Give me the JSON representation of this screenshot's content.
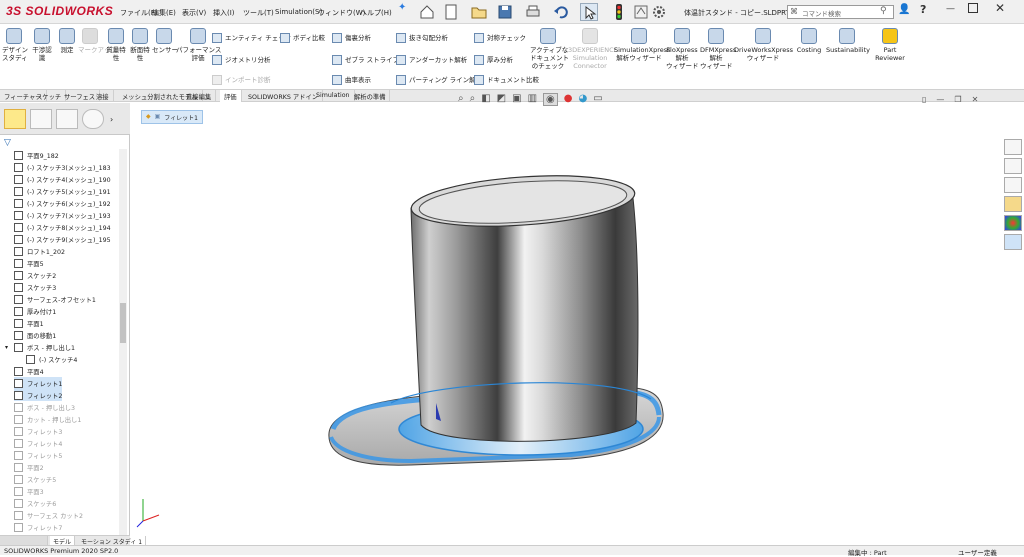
{
  "app": {
    "logo_mark": "3S",
    "logo_text": "SOLIDWORKS",
    "document_title": "体温計スタンド - コピー.SLDPRT *",
    "search_placeholder": "コマンド検索"
  },
  "menus": [
    "ファイル(F)",
    "編集(E)",
    "表示(V)",
    "挿入(I)",
    "ツール(T)",
    "Simulation(S)",
    "ウィンドウ(W)",
    "ヘルプ(H)"
  ],
  "ribbon": {
    "big_left": [
      {
        "label": "デザイン\nスタディ"
      },
      {
        "label": "干渉認\n識"
      },
      {
        "label": "測定"
      },
      {
        "label": "マークアップ",
        "disabled": true
      },
      {
        "label": "質量特\n性"
      },
      {
        "label": "断面特\n性"
      },
      {
        "label": "センサー"
      },
      {
        "label": "パフォーマンス\n評価"
      }
    ],
    "small_col1": [
      {
        "label": "エンティティ チェック"
      },
      {
        "label": "ジオメトリ分析"
      },
      {
        "label": "インポート診断",
        "disabled": true
      }
    ],
    "small_col1b": [
      {
        "label": "ボディ比較"
      }
    ],
    "small_col2": [
      {
        "label": "傷裏分析"
      },
      {
        "label": "ゼブラ ストライプ"
      },
      {
        "label": "曲率表示"
      }
    ],
    "small_col3": [
      {
        "label": "抜き勾配分析"
      },
      {
        "label": "アンダーカット解析"
      },
      {
        "label": "パーティング ライン解析"
      }
    ],
    "small_col4": [
      {
        "label": "対称チェック"
      },
      {
        "label": "厚み分析"
      },
      {
        "label": "ドキュメント比較"
      }
    ],
    "big_right": [
      {
        "label": "アクティブな\nドキュメント\nのチェック"
      },
      {
        "label": "3DEXPERIENCE\nSimulation\nConnector",
        "disabled": true
      },
      {
        "label": "SimulationXpress\n解析ウィザード"
      },
      {
        "label": "FloXpress\n解析\nウィザード"
      },
      {
        "label": "DFMXpress\n解析\nウィザード"
      },
      {
        "label": "DriveWorksXpress\nウィザード"
      },
      {
        "label": "Costing"
      },
      {
        "label": "Sustainability"
      },
      {
        "label": "Part\nReviewer"
      }
    ]
  },
  "tabs": [
    {
      "label": "フィーチャー"
    },
    {
      "label": "スケッチ"
    },
    {
      "label": "サーフェス"
    },
    {
      "label": "溶接"
    },
    {
      "label": "メッシュ分割されたモデル"
    },
    {
      "label": "直接編集"
    },
    {
      "label": "評価",
      "active": true
    },
    {
      "label": "SOLIDWORKS アドイン"
    },
    {
      "label": "Simulation"
    },
    {
      "label": "解析の準備"
    }
  ],
  "breadcrumb": [
    "フィレット1"
  ],
  "tree": [
    {
      "label": "平面9_182",
      "indent": 0
    },
    {
      "label": "(-) スケッチ3(メッシュ)_183",
      "indent": 0
    },
    {
      "label": "(-) スケッチ4(メッシュ)_190",
      "indent": 0
    },
    {
      "label": "(-) スケッチ5(メッシュ)_191",
      "indent": 0
    },
    {
      "label": "(-) スケッチ6(メッシュ)_192",
      "indent": 0
    },
    {
      "label": "(-) スケッチ7(メッシュ)_193",
      "indent": 0
    },
    {
      "label": "(-) スケッチ8(メッシュ)_194",
      "indent": 0
    },
    {
      "label": "(-) スケッチ9(メッシュ)_195",
      "indent": 0
    },
    {
      "label": "ロフト1_202",
      "indent": 0
    },
    {
      "label": "平面5",
      "indent": 0
    },
    {
      "label": "スケッチ2",
      "indent": 0
    },
    {
      "label": "スケッチ3",
      "indent": 0
    },
    {
      "label": "サーフェス-オフセット1",
      "indent": 0
    },
    {
      "label": "厚み付け1",
      "indent": 0
    },
    {
      "label": "平面1",
      "indent": 0
    },
    {
      "label": "面の移動1",
      "indent": 0
    },
    {
      "label": "ボス - 押し出し1",
      "indent": 0,
      "expanded": true
    },
    {
      "label": "(-) スケッチ4",
      "indent": 1
    },
    {
      "label": "平面4",
      "indent": 0
    },
    {
      "label": "フィレット1",
      "indent": 0,
      "selected": true
    },
    {
      "label": "フィレット2",
      "indent": 0,
      "selected": true
    },
    {
      "label": "ボス - 押し出し3",
      "indent": 0,
      "grey": true
    },
    {
      "label": "カット - 押し出し1",
      "indent": 0,
      "grey": true
    },
    {
      "label": "フィレット3",
      "indent": 0,
      "grey": true
    },
    {
      "label": "フィレット4",
      "indent": 0,
      "grey": true
    },
    {
      "label": "フィレット5",
      "indent": 0,
      "grey": true
    },
    {
      "label": "平面2",
      "indent": 0,
      "grey": true
    },
    {
      "label": "スケッチ5",
      "indent": 0,
      "grey": true
    },
    {
      "label": "平面3",
      "indent": 0,
      "grey": true
    },
    {
      "label": "スケッチ6",
      "indent": 0,
      "grey": true
    },
    {
      "label": "サーフェス カット2",
      "indent": 0,
      "grey": true
    },
    {
      "label": "フィレット7",
      "indent": 0,
      "grey": true
    }
  ],
  "bottom_tabs": [
    "モデル",
    "モーション スタディ 1"
  ],
  "status": {
    "left": "SOLIDWORKS Premium 2020 SP2.0",
    "editing": "編集中 : Part",
    "units": "ユーザー定義"
  }
}
